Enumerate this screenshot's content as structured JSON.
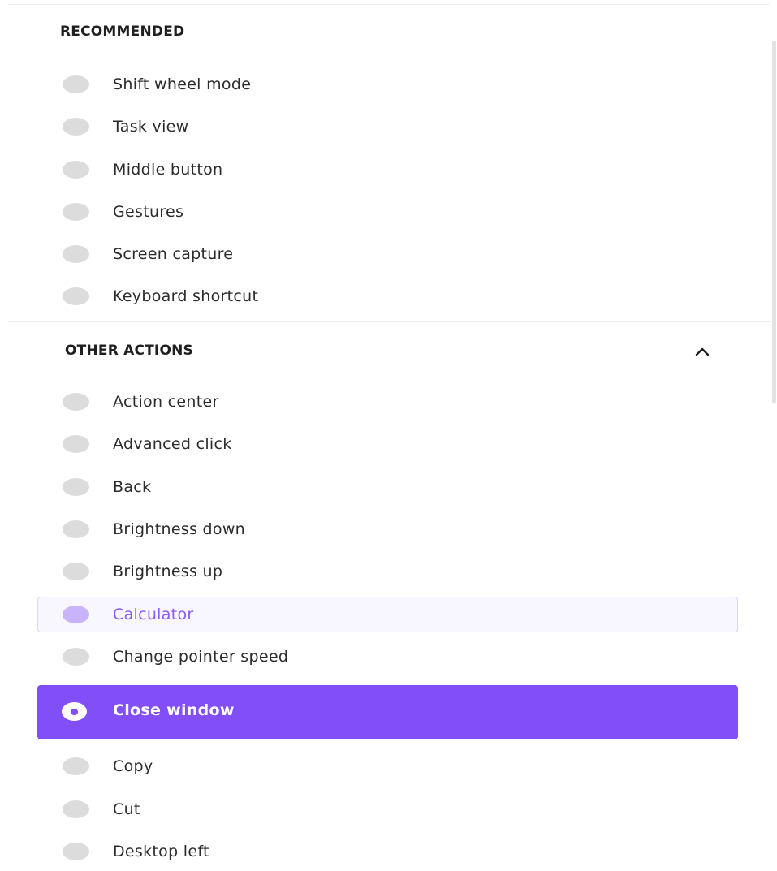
{
  "sections": {
    "recommended": {
      "title": "RECOMMENDED",
      "items": [
        {
          "label": "Shift wheel mode"
        },
        {
          "label": "Task view"
        },
        {
          "label": "Middle button"
        },
        {
          "label": "Gestures"
        },
        {
          "label": "Screen capture"
        },
        {
          "label": "Keyboard shortcut"
        }
      ]
    },
    "other_actions": {
      "title": "OTHER ACTIONS",
      "collapse_icon": "chevron-up-icon",
      "items": [
        {
          "label": "Action center"
        },
        {
          "label": "Advanced click"
        },
        {
          "label": "Back"
        },
        {
          "label": "Brightness down"
        },
        {
          "label": "Brightness up"
        },
        {
          "label": "Calculator",
          "state": "hover"
        },
        {
          "label": "Change pointer speed"
        },
        {
          "label": "Close window",
          "state": "selected"
        },
        {
          "label": "Copy"
        },
        {
          "label": "Cut"
        },
        {
          "label": "Desktop left"
        }
      ]
    }
  },
  "colors": {
    "accent": "#814ef7",
    "hover_background": "#f8f6ff",
    "hover_text": "#8a5cf6",
    "radio_unselected": "#dcdcdc"
  }
}
